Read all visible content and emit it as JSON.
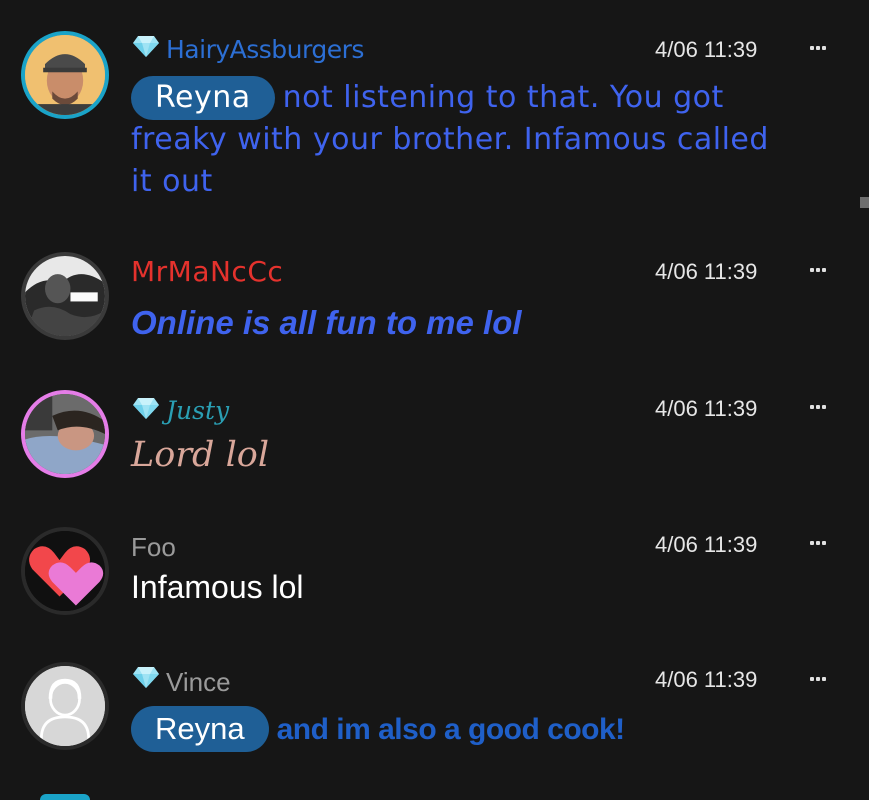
{
  "messages": [
    {
      "username": "HairyAssburgers",
      "time": "4/06 11:39",
      "mention": "Reyna",
      "lines": [
        "not listening to that. You got",
        "freaky with your brother. Infamous called",
        "it out"
      ]
    },
    {
      "username": "MrMaNcCc",
      "time": "4/06 11:39",
      "text": "Online is all fun to me lol"
    },
    {
      "username": "Justy",
      "time": "4/06 11:39",
      "text": "Lord lol"
    },
    {
      "username": "Foo",
      "time": "4/06 11:39",
      "text": "Infamous lol"
    },
    {
      "username": "Vince",
      "time": "4/06 11:39",
      "mention": "Reyna",
      "text": "and im also a good cook!"
    }
  ],
  "icons": {
    "badge": "diamond-icon",
    "menu": "more-options-icon"
  },
  "colors": {
    "background": "#161616",
    "username_blue": "#2c6fd4",
    "username_red": "#e5322d",
    "username_teal": "#2a9fb4",
    "username_gray": "#9a9a9a",
    "message_blue": "#3f63ee",
    "mention_bg": "#1f5f96",
    "justy_text": "#d9a79a"
  }
}
